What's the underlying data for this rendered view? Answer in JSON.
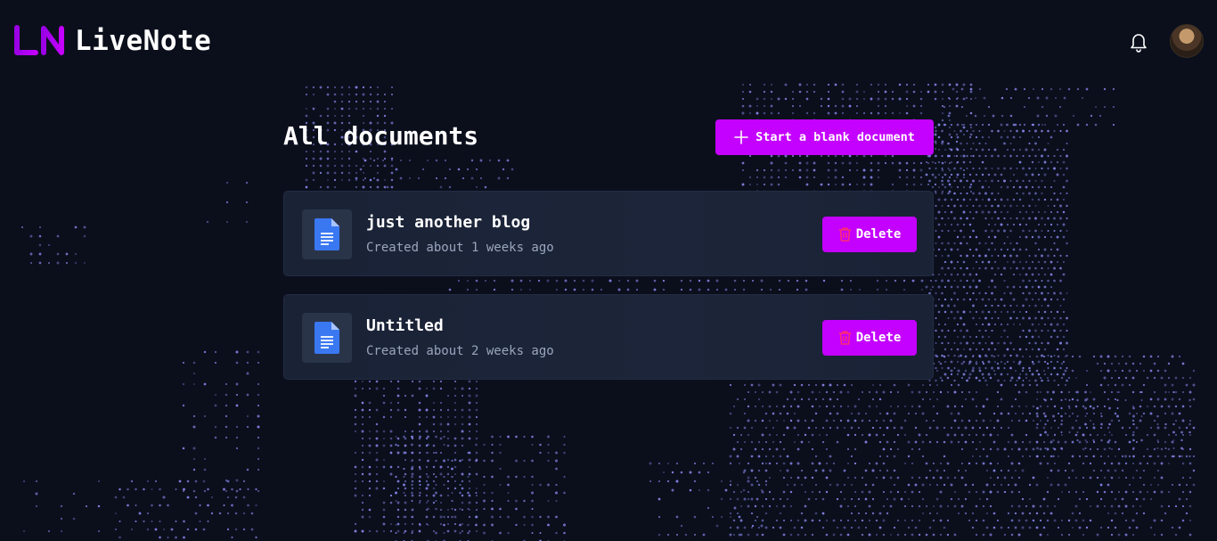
{
  "app": {
    "logo_mark": "LN",
    "name": "LiveNote"
  },
  "header": {
    "notification_icon": "bell-icon",
    "avatar_icon": "user-avatar"
  },
  "main": {
    "title": "All documents",
    "new_document_label": "Start a blank document",
    "documents": [
      {
        "title": "just another blog",
        "meta": "Created about 1 weeks ago",
        "delete_label": "Delete"
      },
      {
        "title": "Untitled",
        "meta": "Created about 2 weeks ago",
        "delete_label": "Delete"
      }
    ]
  },
  "colors": {
    "background": "#0b0f1c",
    "accent": "#c400ff",
    "card": "#1a2236",
    "doc_icon": "#3a78f2",
    "delete_icon": "#ff2d6f",
    "dot_map": "#8e8cf5"
  }
}
